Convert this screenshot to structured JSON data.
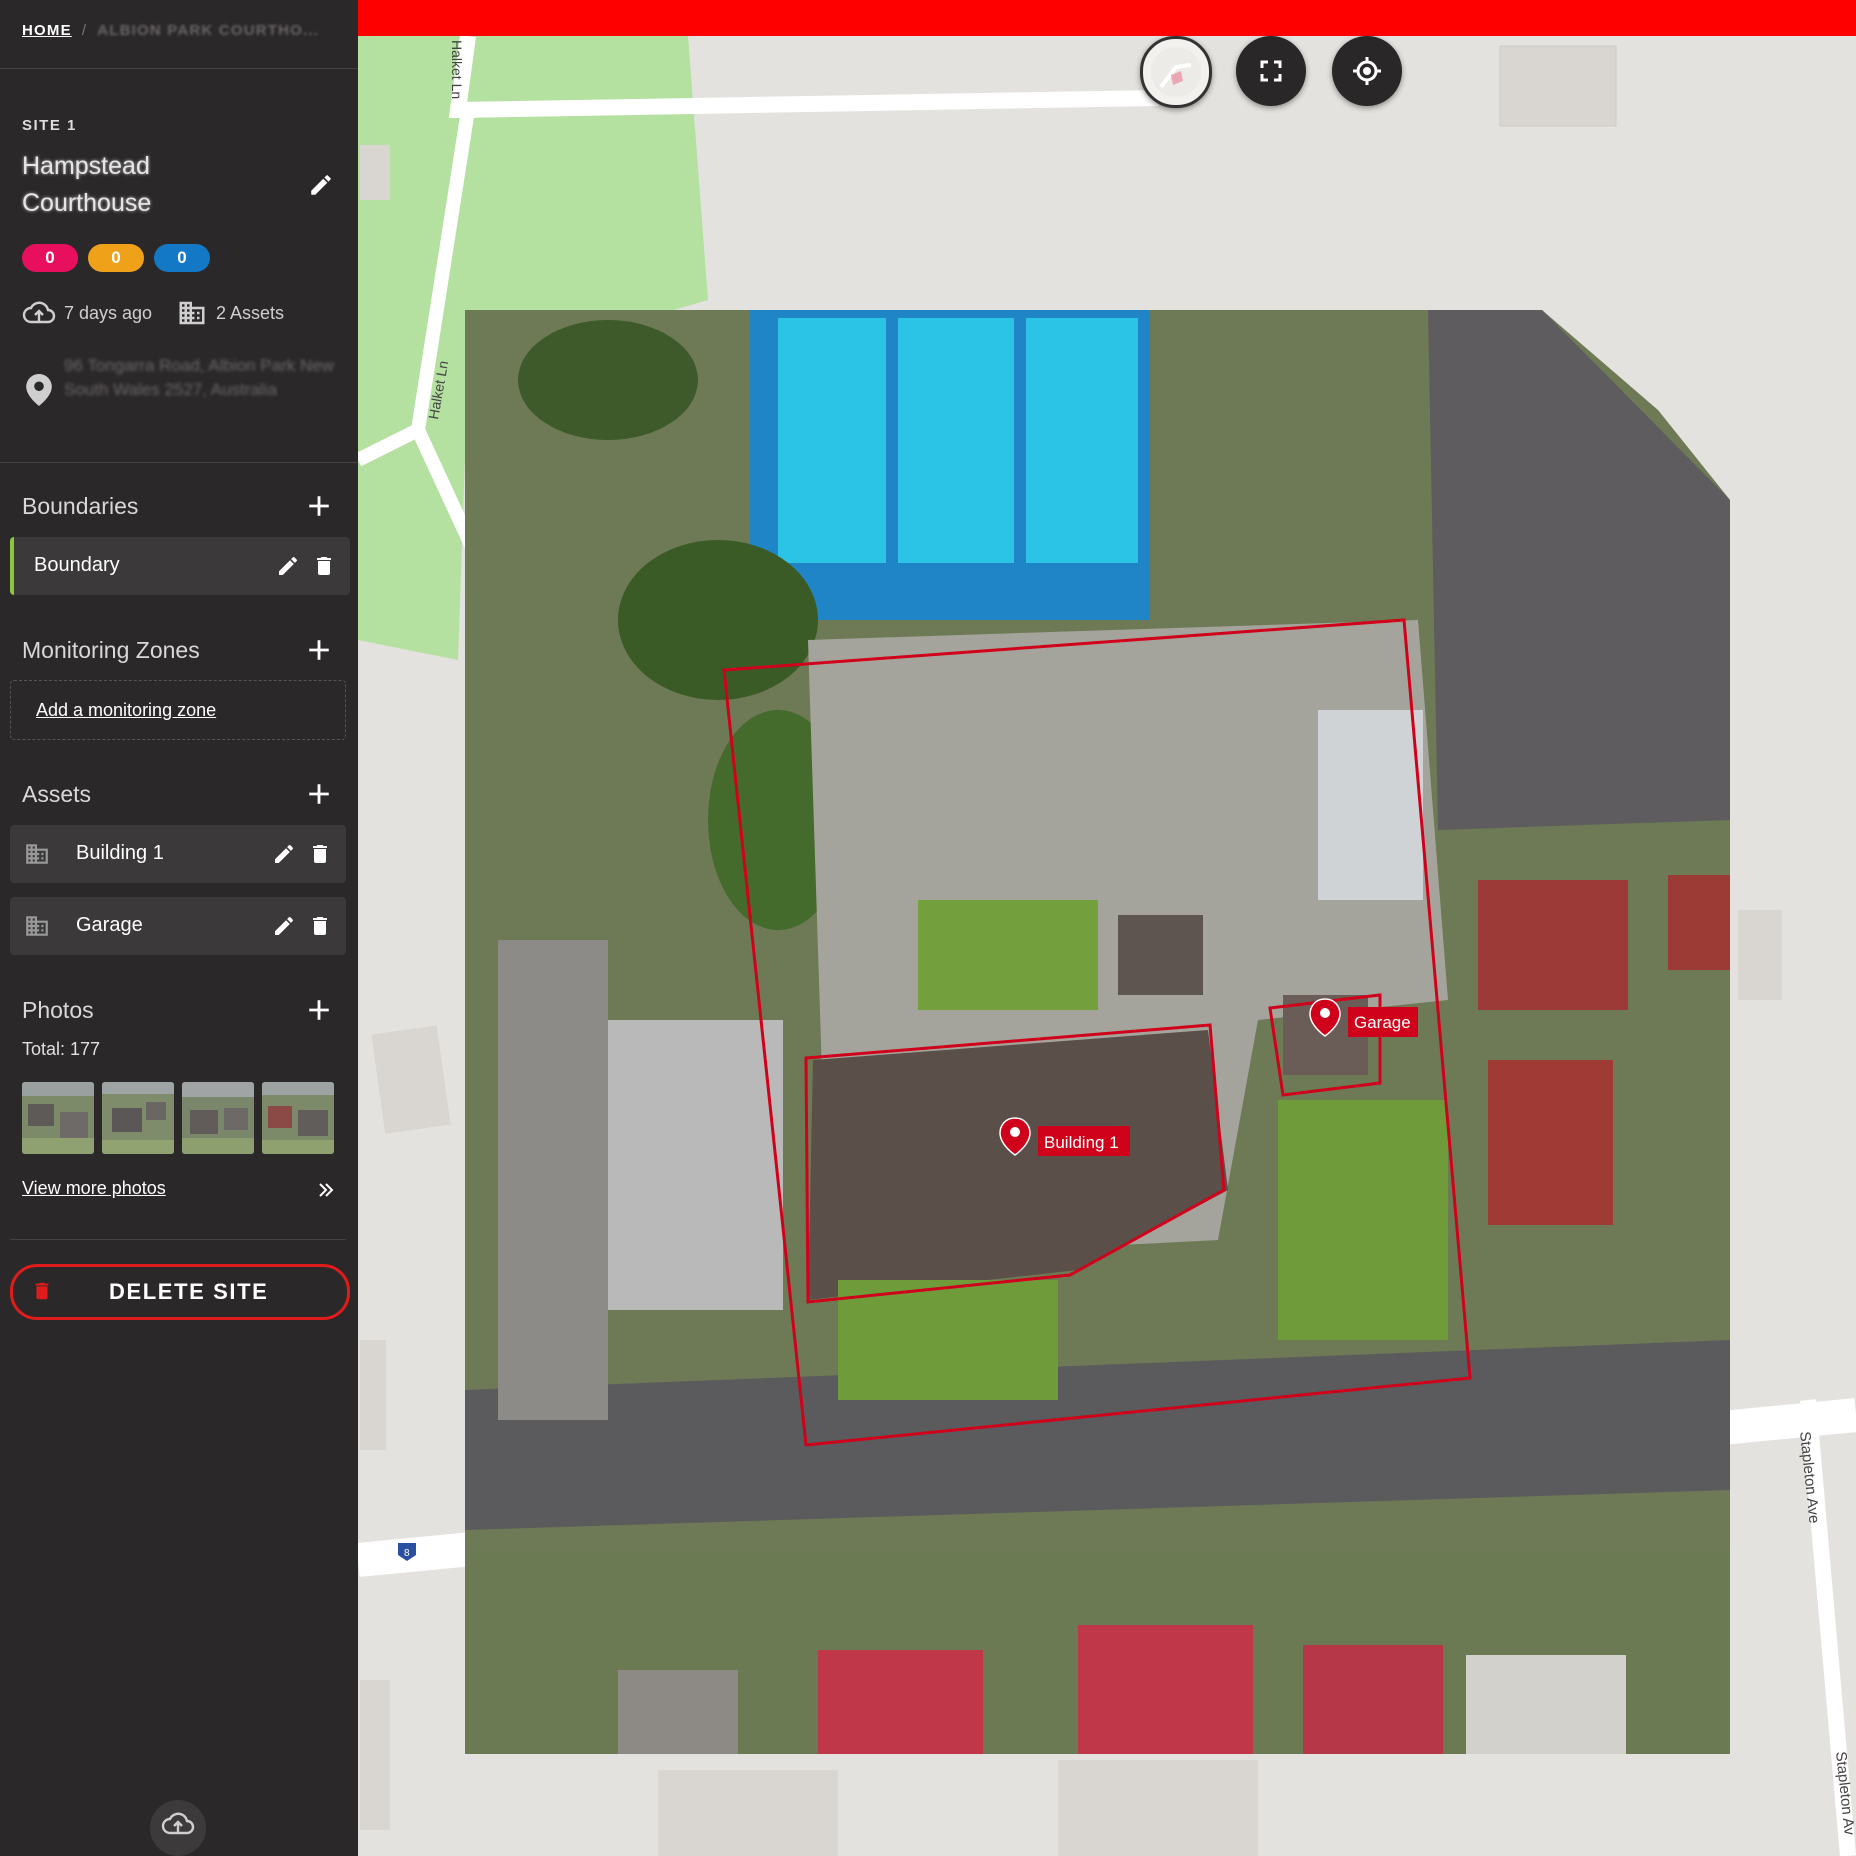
{
  "breadcrumb": {
    "home": "HOME",
    "separator": "/",
    "current": "ALBION PARK COURTHO..."
  },
  "site": {
    "label": "SITE 1",
    "name": "Hampstead Courthouse",
    "badges": [
      {
        "value": "0",
        "color": "#e8105e"
      },
      {
        "value": "0",
        "color": "#f0a11a"
      },
      {
        "value": "0",
        "color": "#1378c6"
      }
    ],
    "uploaded": "7 days ago",
    "assets_count": "2 Assets",
    "address": "96 Tongarra Road, Albion Park New South Wales 2527, Australia"
  },
  "boundaries": {
    "title": "Boundaries",
    "items": [
      {
        "label": "Boundary",
        "accent": "#8cc63f"
      }
    ]
  },
  "monitoring_zones": {
    "title": "Monitoring Zones",
    "add_link": "Add a monitoring zone"
  },
  "assets": {
    "title": "Assets",
    "items": [
      {
        "label": "Building 1"
      },
      {
        "label": "Garage"
      }
    ]
  },
  "photos": {
    "title": "Photos",
    "total": "Total: 177",
    "view_more": "View more photos"
  },
  "actions": {
    "delete_site": "DELETE SITE"
  },
  "map": {
    "topbar_color": "#ff0000",
    "street_labels": [
      "Halket Ln",
      "Halket Ln",
      "Stapleton Ave",
      "Stapleton Av"
    ],
    "shield": "8",
    "markers": [
      {
        "label": "Building 1"
      },
      {
        "label": "Garage"
      }
    ],
    "boundary_color": "#d0021b",
    "controls": [
      "minimap-icon",
      "fullscreen-icon",
      "locate-icon"
    ]
  }
}
